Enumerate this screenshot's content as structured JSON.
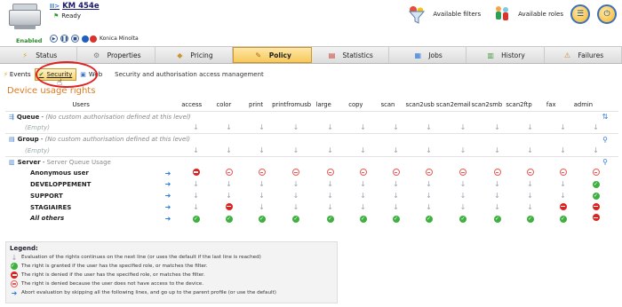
{
  "header": {
    "printer_prefix": "II>",
    "printer_name": "KM 454e",
    "status": "Ready",
    "enabled": "Enabled",
    "brand": "Konica Minolta",
    "features": [
      {
        "icon": "filter-funnel-icon",
        "label": "Available filters"
      },
      {
        "icon": "roles-icon",
        "label": "Available roles"
      }
    ]
  },
  "tabs": [
    {
      "name": "status",
      "label": "Status",
      "icon": "status-icon",
      "active": false
    },
    {
      "name": "properties",
      "label": "Properties",
      "icon": "properties-icon",
      "active": false
    },
    {
      "name": "pricing",
      "label": "Pricing",
      "icon": "pricing-icon",
      "active": false
    },
    {
      "name": "policy",
      "label": "Policy",
      "icon": "policy-icon",
      "active": true
    },
    {
      "name": "statistics",
      "label": "Statistics",
      "icon": "statistics-icon",
      "active": false
    },
    {
      "name": "jobs",
      "label": "Jobs",
      "icon": "jobs-icon",
      "active": false
    },
    {
      "name": "history",
      "label": "History",
      "icon": "history-icon",
      "active": false
    },
    {
      "name": "failures",
      "label": "Failures",
      "icon": "failures-icon",
      "active": false
    }
  ],
  "subtabs": {
    "events": "Events",
    "security": "Security",
    "web": "Web",
    "description": "Security and authorisation access management"
  },
  "section_title": "Device usage rights",
  "columns": [
    "Users",
    "access",
    "color",
    "print",
    "printfromusb",
    "large",
    "copy",
    "scan",
    "scan2usb",
    "scan2email",
    "scan2smb",
    "scan2ftp",
    "fax",
    "admin"
  ],
  "rows": {
    "queue": {
      "name": "Queue",
      "note": "(No custom authorisation defined at this level)"
    },
    "queue_empty": "(Empty)",
    "group": {
      "name": "Group",
      "note": "(No custom authorisation defined at this level)"
    },
    "group_empty": "(Empty)",
    "server": {
      "name": "Server",
      "note": "Server Queue Usage"
    },
    "users": [
      {
        "name": "Anonymous user",
        "cells": [
          "no",
          "na",
          "na",
          "na",
          "na",
          "na",
          "na",
          "na",
          "na",
          "na",
          "na",
          "na",
          "na"
        ]
      },
      {
        "name": "DEVELOPPEMENT",
        "cells": [
          "dn",
          "dn",
          "dn",
          "dn",
          "dn",
          "dn",
          "dn",
          "dn",
          "dn",
          "dn",
          "dn",
          "dn",
          "ok"
        ]
      },
      {
        "name": "SUPPORT",
        "cells": [
          "dn",
          "dn",
          "dn",
          "dn",
          "dn",
          "dn",
          "dn",
          "dn",
          "dn",
          "dn",
          "dn",
          "dn",
          "ok"
        ]
      },
      {
        "name": "STAGIAIRES",
        "cells": [
          "dn",
          "no",
          "dn",
          "dn",
          "dn",
          "dn",
          "dn",
          "dn",
          "dn",
          "dn",
          "dn",
          "no",
          "no"
        ]
      },
      {
        "name": "All others",
        "cells": [
          "ok",
          "ok",
          "ok",
          "ok",
          "ok",
          "ok",
          "ok",
          "ok",
          "ok",
          "ok",
          "ok",
          "ok",
          "no"
        ]
      }
    ]
  },
  "legend": {
    "title": "Legend:",
    "items": [
      {
        "sym": "dn",
        "text": "Evaluation of the rights continues on the next line (or uses the default if the last line is reached)"
      },
      {
        "sym": "ok",
        "text": "The right is granted if the user has the specified role, or matches the filter."
      },
      {
        "sym": "no",
        "text": "The right is denied if the user has the specified role, or matches the filter."
      },
      {
        "sym": "na",
        "text": "The right is denied because the user does not have access to the device."
      },
      {
        "sym": "arrow",
        "text": "Abort evaluation by skipping all the following lines, and go up to the parent profile (or use the default)"
      }
    ]
  },
  "colors": {
    "accent": "#e07a1f",
    "active_tab": "#f6c85b",
    "granted": "#3fb03f",
    "denied": "#e0201c"
  }
}
